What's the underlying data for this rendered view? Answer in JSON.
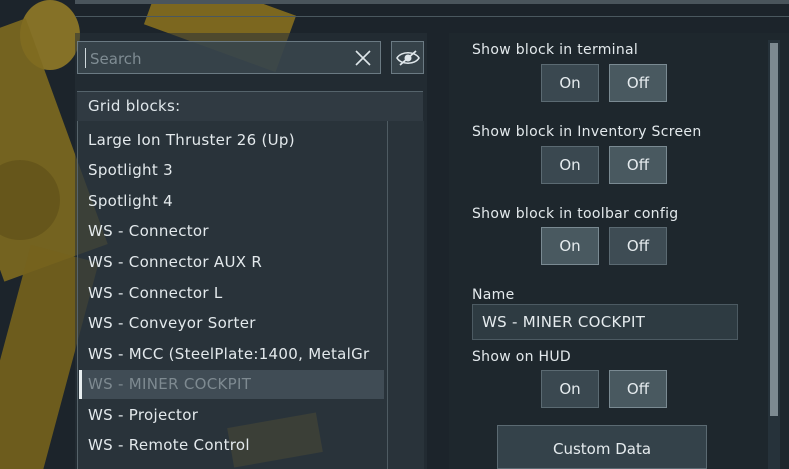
{
  "search": {
    "placeholder": "Search"
  },
  "grid_blocks": {
    "header": "Grid blocks:",
    "items": [
      "Large Ion Thruster 26 (Up)",
      "Spotlight 3",
      "Spotlight 4",
      "WS - Connector",
      "WS - Connector AUX R",
      "WS - Connector L",
      "WS - Conveyor Sorter",
      "WS - MCC (SteelPlate:1400, MetalGr",
      "WS - MINER COCKPIT",
      "WS - Projector",
      "WS - Remote Control"
    ],
    "selected": "WS - MINER COCKPIT"
  },
  "settings": {
    "show_in_terminal": {
      "label": "Show block in terminal",
      "on": "On",
      "off": "Off",
      "value": "Off"
    },
    "show_in_inventory": {
      "label": "Show block in Inventory Screen",
      "on": "On",
      "off": "Off",
      "value": "Off"
    },
    "show_in_toolbar": {
      "label": "Show block in toolbar config",
      "on": "On",
      "off": "Off",
      "value": "On"
    },
    "name": {
      "label": "Name",
      "value": "WS - MINER COCKPIT"
    },
    "show_on_hud": {
      "label": "Show on HUD",
      "on": "On",
      "off": "Off",
      "value": "Off"
    },
    "custom_data_label": "Custom Data"
  }
}
